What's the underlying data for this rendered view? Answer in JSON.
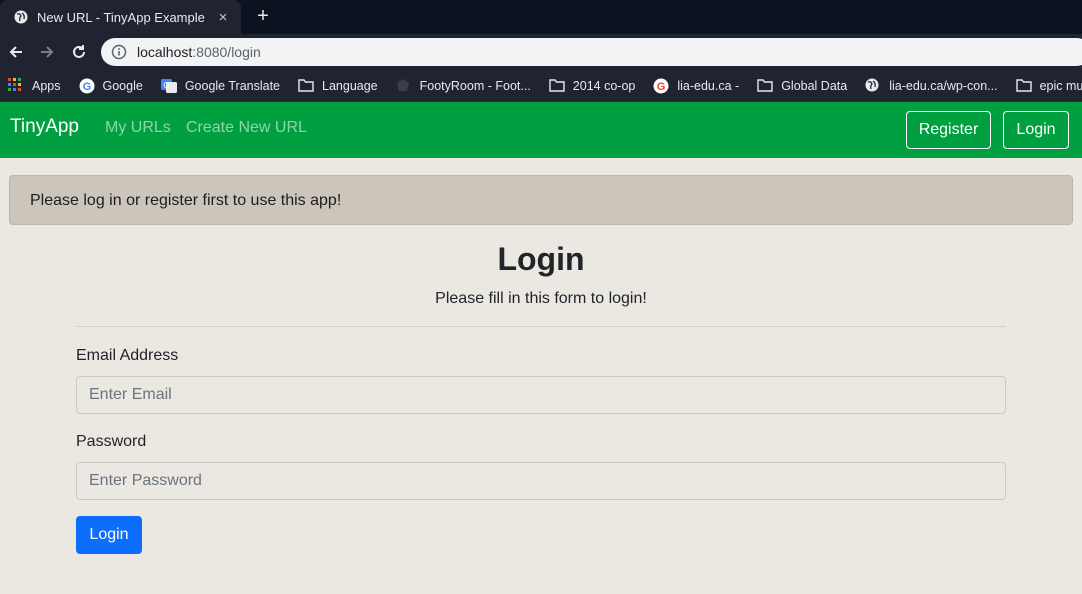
{
  "browser": {
    "tab_title": "New URL - TinyApp Example",
    "tab_close": "×",
    "new_tab": "+",
    "url_host": "localhost",
    "url_rest": ":8080/login",
    "bookmarks": [
      {
        "label": "Apps",
        "icon": "apps-grid-icon"
      },
      {
        "label": "Google",
        "icon": "google-icon"
      },
      {
        "label": "Google Translate",
        "icon": "translate-icon"
      },
      {
        "label": "Language",
        "icon": "folder-icon"
      },
      {
        "label": "FootyRoom - Foot...",
        "icon": "footyroom-icon"
      },
      {
        "label": "2014 co-op",
        "icon": "folder-icon"
      },
      {
        "label": "lia-edu.ca -",
        "icon": "google-icon"
      },
      {
        "label": "Global Data",
        "icon": "folder-icon"
      },
      {
        "label": "lia-edu.ca/wp-con...",
        "icon": "globe-icon"
      },
      {
        "label": "epic mu",
        "icon": "folder-icon"
      }
    ]
  },
  "navbar": {
    "brand": "TinyApp",
    "links": [
      "My URLs",
      "Create New URL"
    ],
    "register": "Register",
    "login": "Login"
  },
  "alert": {
    "message": "Please log in or register first to use this app!"
  },
  "form": {
    "title": "Login",
    "subtitle": "Please fill in this form to login!",
    "email_label": "Email Address",
    "email_placeholder": "Enter Email",
    "password_label": "Password",
    "password_placeholder": "Enter Password",
    "submit": "Login"
  },
  "colors": {
    "navbar": "#00a041",
    "button_primary": "#0d6efd",
    "page_bg": "#ebe7e1",
    "alert_bg": "#cbc5bc"
  }
}
